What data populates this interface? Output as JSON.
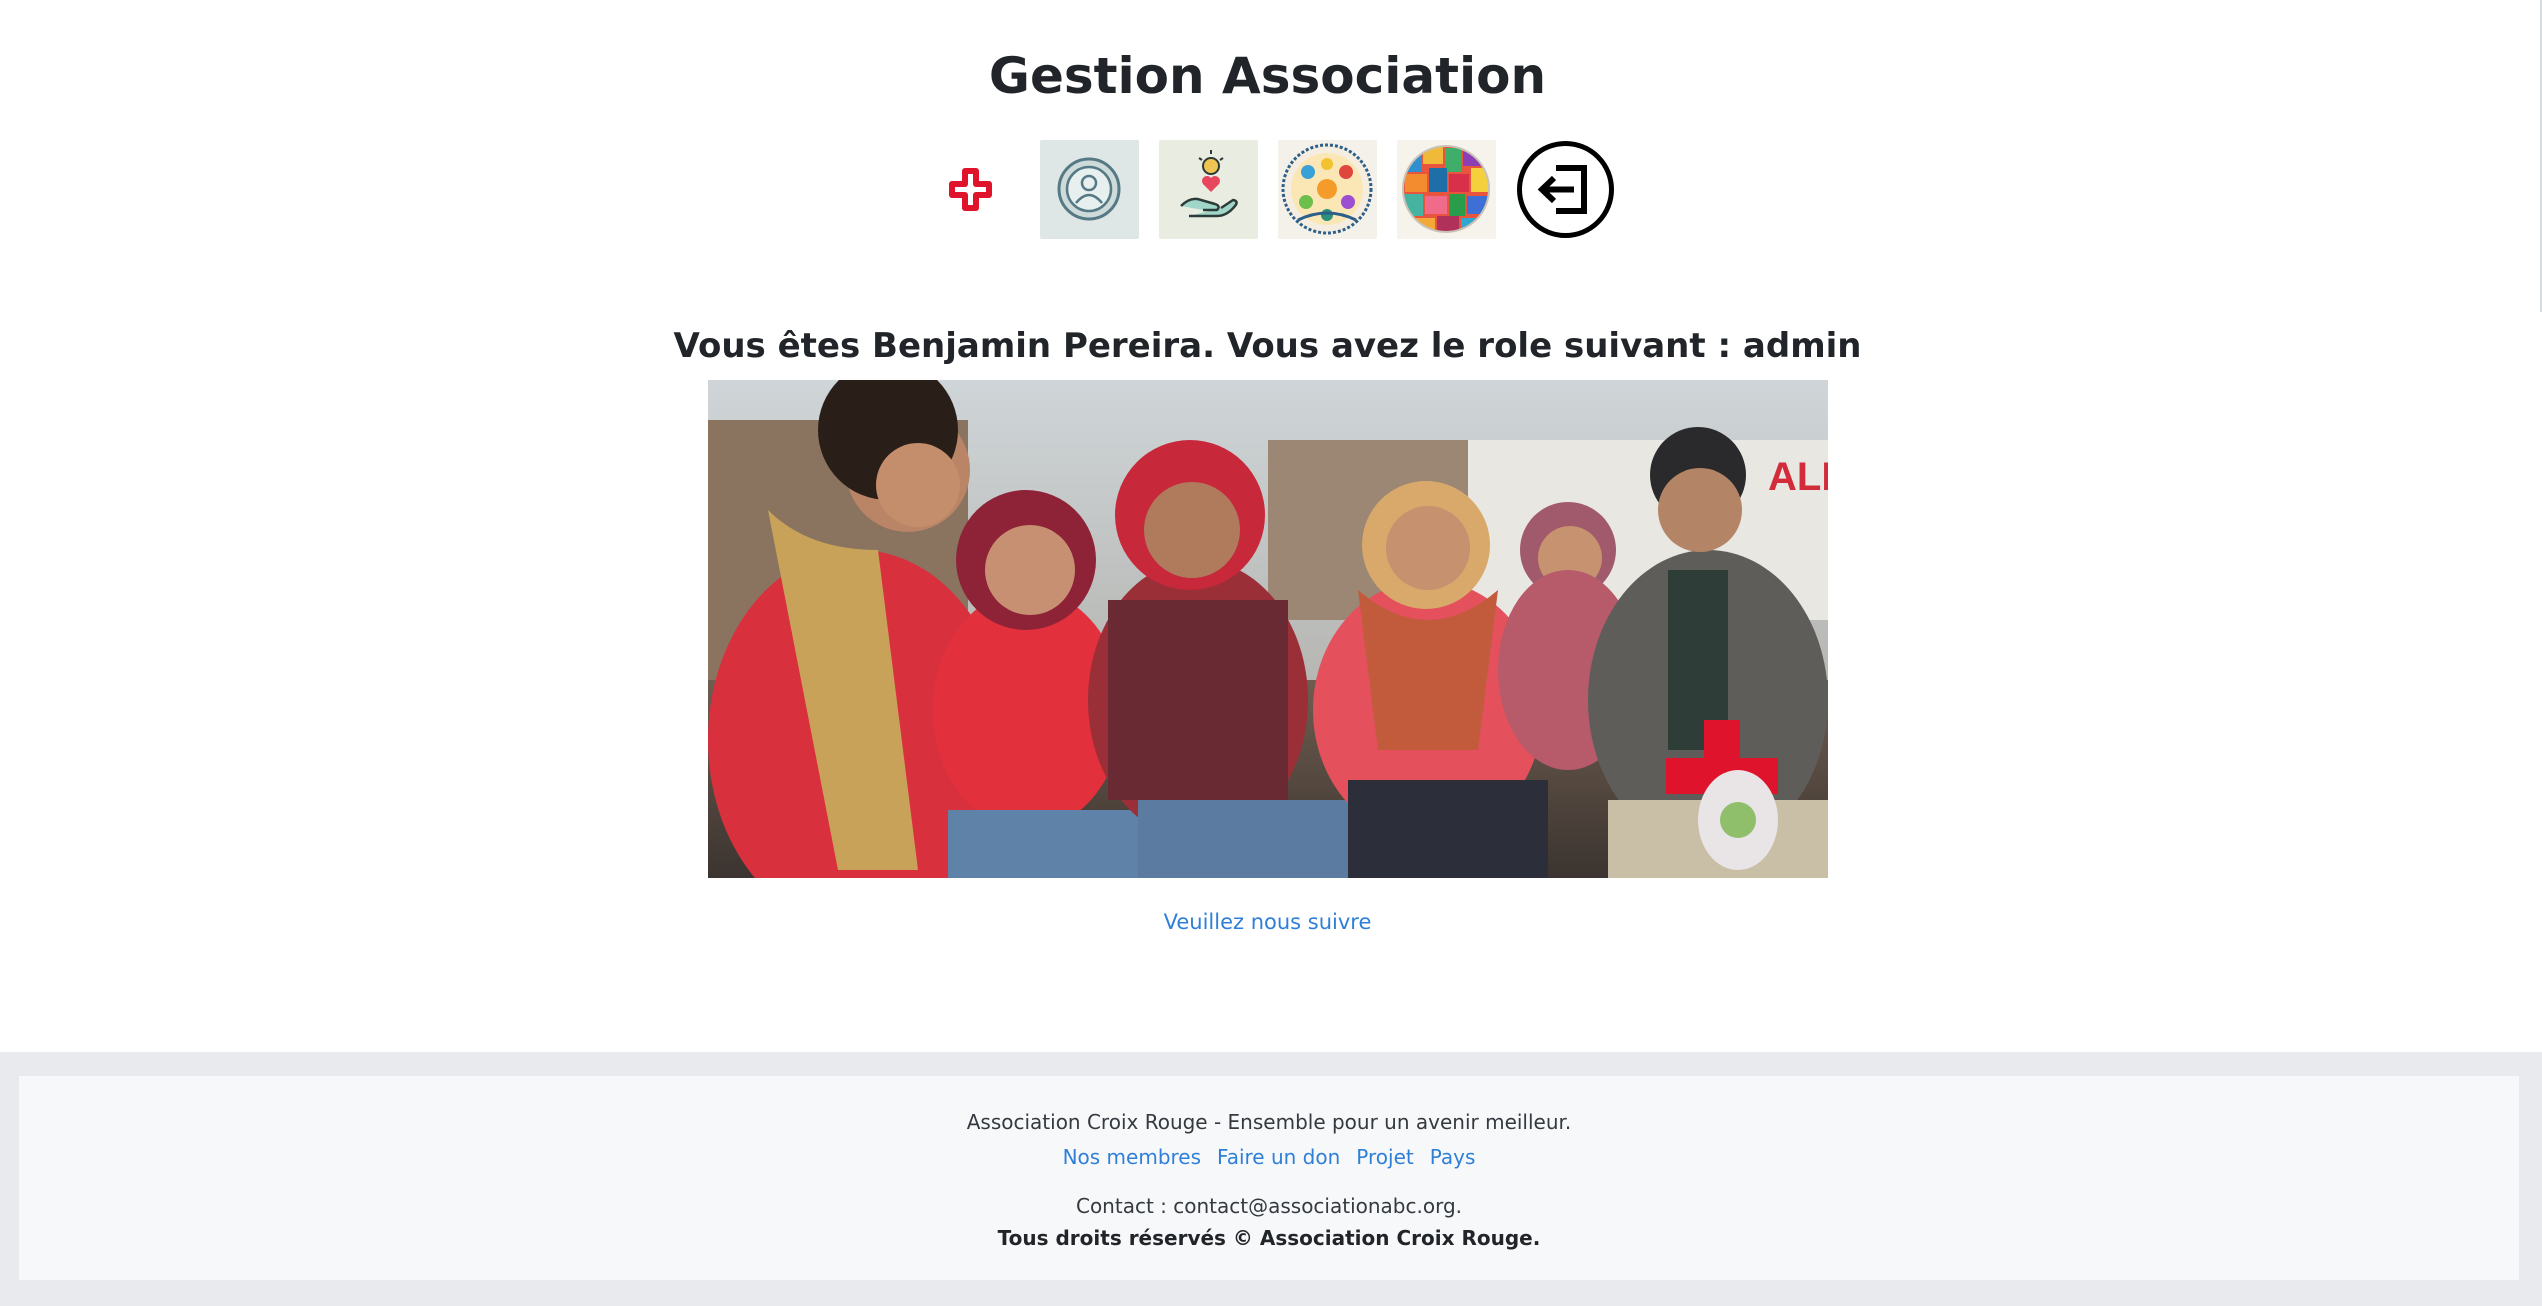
{
  "header": {
    "title": "Gestion Association"
  },
  "nav": {
    "icons": [
      {
        "name": "red-cross-icon"
      },
      {
        "name": "member-profile-icon"
      },
      {
        "name": "donation-hand-icon"
      },
      {
        "name": "community-world-icon"
      },
      {
        "name": "countries-mosaic-icon"
      },
      {
        "name": "logout-icon"
      }
    ]
  },
  "welcome": {
    "text": "Vous êtes Benjamin Pereira. Vous avez le role suivant : admin"
  },
  "hero": {
    "image": "photo-of-volunteers-and-families-with-red-cross-symbol"
  },
  "follow": {
    "label": "Veuillez nous suivre"
  },
  "footer": {
    "tagline": "Association Croix Rouge - Ensemble pour un avenir meilleur.",
    "links": [
      "Nos membres",
      "Faire un don",
      "Projet",
      "Pays"
    ],
    "contact": "Contact : contact@associationabc.org.",
    "rights": "Tous droits réservés © Association Croix Rouge."
  },
  "colors": {
    "link": "#2f7fd8",
    "red_cross": "#e0132c",
    "footer_bg": "#f7f8f9"
  }
}
